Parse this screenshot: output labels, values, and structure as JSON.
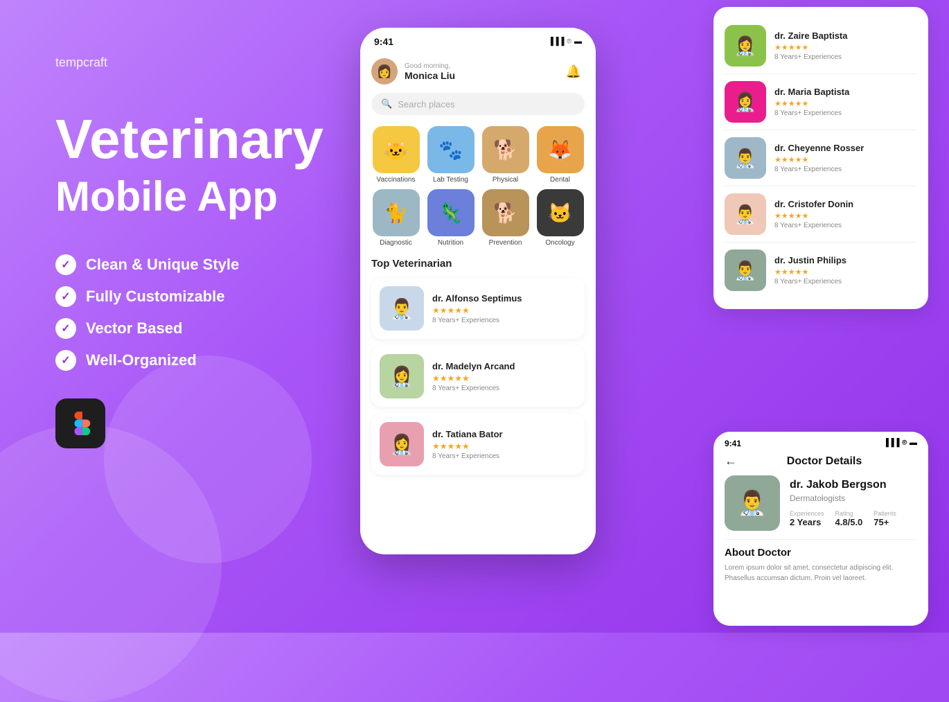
{
  "brand": "tempcraft",
  "hero": {
    "title": "Veterinary",
    "subtitle": "Mobile App"
  },
  "features": [
    "Clean & Unique Style",
    "Fully Customizable",
    "Vector Based",
    "Well-Organized"
  ],
  "phone_main": {
    "status_time": "9:41",
    "greeting": "Good morning,",
    "user_name": "Monica Liu",
    "search_placeholder": "Search places",
    "categories": [
      {
        "label": "Vaccinations",
        "emoji": "🐱",
        "color": "#f5c842"
      },
      {
        "label": "Lab Testing",
        "emoji": "🐾",
        "color": "#7ab8e8"
      },
      {
        "label": "Physical",
        "emoji": "🐕",
        "color": "#d4a96b"
      },
      {
        "label": "Dental",
        "emoji": "🦊",
        "color": "#e8a44a"
      },
      {
        "label": "Diagnostic",
        "emoji": "🐈",
        "color": "#9cb8c5"
      },
      {
        "label": "Nutrition",
        "emoji": "🦎",
        "color": "#6b7fdb"
      },
      {
        "label": "Prevention",
        "emoji": "🐕",
        "color": "#b8945a"
      },
      {
        "label": "Oncology",
        "emoji": "🐱",
        "color": "#3a3a3a"
      }
    ],
    "top_vet_title": "Top Veterinarian",
    "vets": [
      {
        "name": "dr. Alfonso Septimus",
        "stars": "★★★★★",
        "exp": "8 Years+ Experiences",
        "emoji": "👨‍⚕️",
        "color": "#c8d8e8"
      },
      {
        "name": "dr. Madelyn Arcand",
        "stars": "★★★★★",
        "exp": "8 Years+ Experiences",
        "emoji": "👩‍⚕️",
        "color": "#b8d4a0"
      },
      {
        "name": "dr. Tatiana Bator",
        "stars": "★★★★★",
        "exp": "8 Years+ Experiences",
        "emoji": "👩‍⚕️",
        "color": "#e8a0b0"
      }
    ]
  },
  "doctor_panel": {
    "doctors": [
      {
        "name": "dr. Zaire Baptista",
        "stars": "★★★★★",
        "exp": "8 Years+ Experiences",
        "emoji": "👩‍⚕️",
        "color": "#8BC34A"
      },
      {
        "name": "dr. Maria Baptista",
        "stars": "★★★★★",
        "exp": "8 Years+ Experiences",
        "emoji": "👩‍⚕️",
        "color": "#e91e8c"
      },
      {
        "name": "dr. Cheyenne Rosser",
        "stars": "★★★★★",
        "exp": "8 Years+ Experiences",
        "emoji": "👨‍⚕️",
        "color": "#9eb8c8"
      },
      {
        "name": "dr. Cristofer Donin",
        "stars": "★★★★★",
        "exp": "8 Years+ Experiences",
        "emoji": "👨‍⚕️",
        "color": "#f0c8b8"
      },
      {
        "name": "dr. Justin Philips",
        "stars": "★★★★★",
        "exp": "8 Years+ Experiences",
        "emoji": "👨‍⚕️",
        "color": "#8fa898"
      }
    ]
  },
  "detail_screen": {
    "status_time": "9:41",
    "title": "Doctor Details",
    "doctor": {
      "name": "dr. Jakob Bergson",
      "specialty": "Dermatologists",
      "experiences_label": "Experiences",
      "experiences_value": "2 Years",
      "rating_label": "Rating",
      "rating_value": "4.8/5.0",
      "patients_label": "Patients",
      "patients_value": "75+",
      "emoji": "👨‍⚕️",
      "color": "#8fa898"
    },
    "about_title": "About Doctor",
    "about_text": "Lorem ipsum dolor sit amet, consectetur adipiscing elit. Phasellus accumsan dictum. Proin vel laoreet."
  },
  "star_color": "#f5a623"
}
